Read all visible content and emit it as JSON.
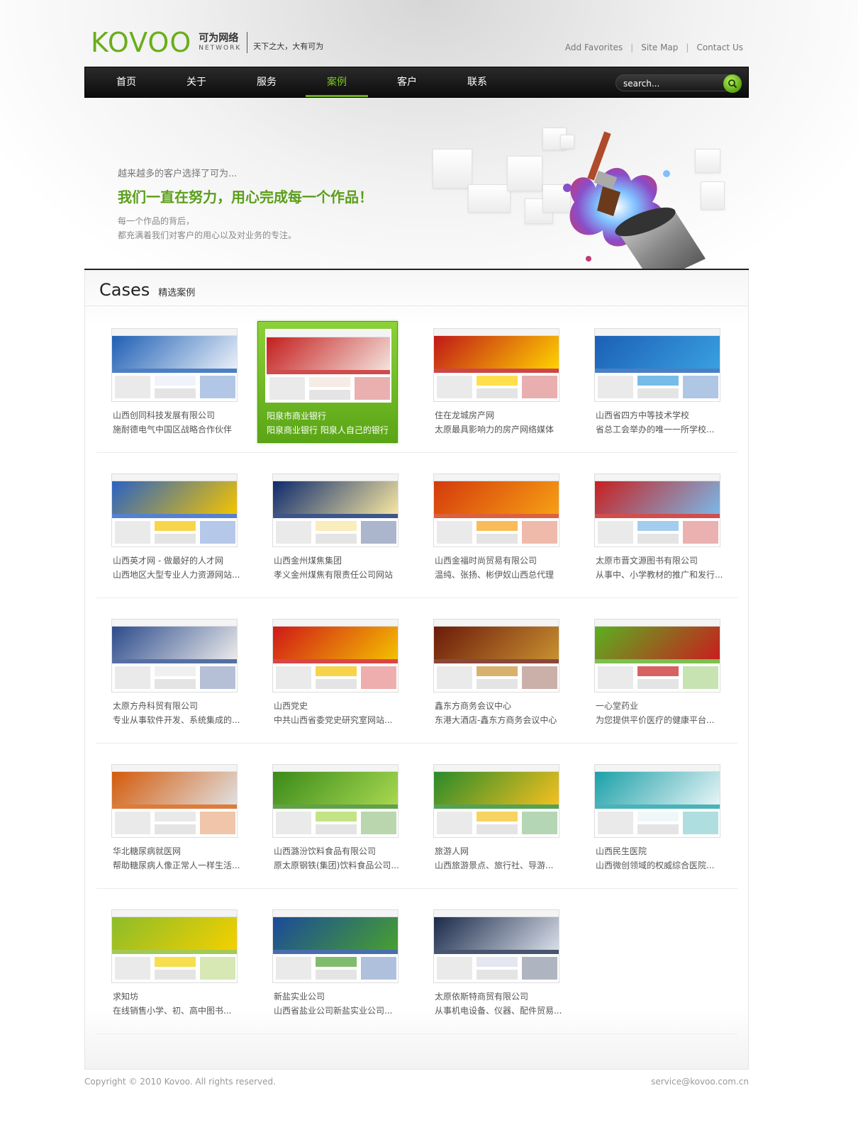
{
  "header": {
    "logo": "KOVOO",
    "logo_cn": "可为网络",
    "logo_en": "NETWORK",
    "slogan": "天下之大，大有可为",
    "links": [
      "Add Favorites",
      "Site Map",
      "Contact Us"
    ],
    "link_separator": "|"
  },
  "nav": {
    "items": [
      "首页",
      "关于",
      "服务",
      "案例",
      "客户",
      "联系"
    ],
    "active_index": 3,
    "search_placeholder": "search..."
  },
  "banner": {
    "small": "越来越多的客户选择了可为...",
    "big": "我们一直在努力，用心完成每一个作品！",
    "desc_line1": "每一个作品的背后，",
    "desc_line2": "都充满着我们对客户的用心以及对业务的专注。"
  },
  "cases": {
    "title": "Cases",
    "subtitle": "精选案例",
    "items": [
      {
        "name": "山西创同科技发展有限公司",
        "desc": "施耐德电气中国区战略合作伙伴"
      },
      {
        "name": "阳泉市商业银行",
        "desc": "阳泉商业银行 阳泉人自己的银行"
      },
      {
        "name": "住在龙城房产网",
        "desc": "太原最具影响力的房产网络媒体"
      },
      {
        "name": "山西省四方中等技术学校",
        "desc": "省总工会举办的唯一一所学校..."
      },
      {
        "name": "山西英才网 - 做最好的人才网",
        "desc": "山西地区大型专业人力资源网站..."
      },
      {
        "name": "山西金州煤焦集团",
        "desc": "孝义金州煤焦有限责任公司网站"
      },
      {
        "name": "山西金福时尚贸易有限公司",
        "desc": "温纯、张扬、彬伊奴山西总代理"
      },
      {
        "name": "太原市晋文源图书有限公司",
        "desc": "从事中、小学教材的推广和发行..."
      },
      {
        "name": "太原方舟科贸有限公司",
        "desc": "专业从事软件开发、系统集成的..."
      },
      {
        "name": "山西党史",
        "desc": "中共山西省委党史研究室网站..."
      },
      {
        "name": "鑫东方商务会议中心",
        "desc": "东港大酒店-鑫东方商务会议中心"
      },
      {
        "name": "一心堂药业",
        "desc": "为您提供平价医疗的健康平台..."
      },
      {
        "name": "华北糖尿病就医网",
        "desc": "帮助糖尿病人像正常人一样生活..."
      },
      {
        "name": "山西潞汾饮料食品有限公司",
        "desc": "原太原钢铁(集团)饮料食品公司..."
      },
      {
        "name": "旅游人网",
        "desc": "山西旅游景点、旅行社、导游..."
      },
      {
        "name": "山西民生医院",
        "desc": "山西微创领域的权威综合医院..."
      },
      {
        "name": "求知坊",
        "desc": "在线销售小学、初、高中图书..."
      },
      {
        "name": "新盐实业公司",
        "desc": "山西省盐业公司新盐实业公司..."
      },
      {
        "name": "太原依斯特商贸有限公司",
        "desc": "从事机电设备、仪器、配件贸易..."
      }
    ],
    "active_index": 1,
    "thumb_colors": [
      [
        "#1f5fb5",
        "#e9f0f8"
      ],
      [
        "#c41e1e",
        "#f4e2dc"
      ],
      [
        "#c01818",
        "#ffd200"
      ],
      [
        "#1b5fb5",
        "#3aa0e0"
      ],
      [
        "#2a62c4",
        "#f3c400"
      ],
      [
        "#0d2a6e",
        "#f6e6a0"
      ],
      [
        "#d43a0c",
        "#f6a014"
      ],
      [
        "#c72020",
        "#7ab8e8"
      ],
      [
        "#2c4b8c",
        "#eaeaea"
      ],
      [
        "#d01818",
        "#f3c000"
      ],
      [
        "#6b1a0a",
        "#c89030"
      ],
      [
        "#5bb020",
        "#c81e1e"
      ],
      [
        "#d45a0a",
        "#e0e0e0"
      ],
      [
        "#3a8a1a",
        "#a8d850"
      ],
      [
        "#2a8a2a",
        "#f4c020"
      ],
      [
        "#1ba0a8",
        "#e8f4f6"
      ],
      [
        "#8cbc2a",
        "#f4d000"
      ],
      [
        "#1a4a9a",
        "#48a030"
      ],
      [
        "#1a2a4a",
        "#d8dde8"
      ]
    ]
  },
  "footer": {
    "copyright": "Copyright © 2010 Kovoo. All rights reserved.",
    "email": "service@kovoo.com.cn"
  }
}
